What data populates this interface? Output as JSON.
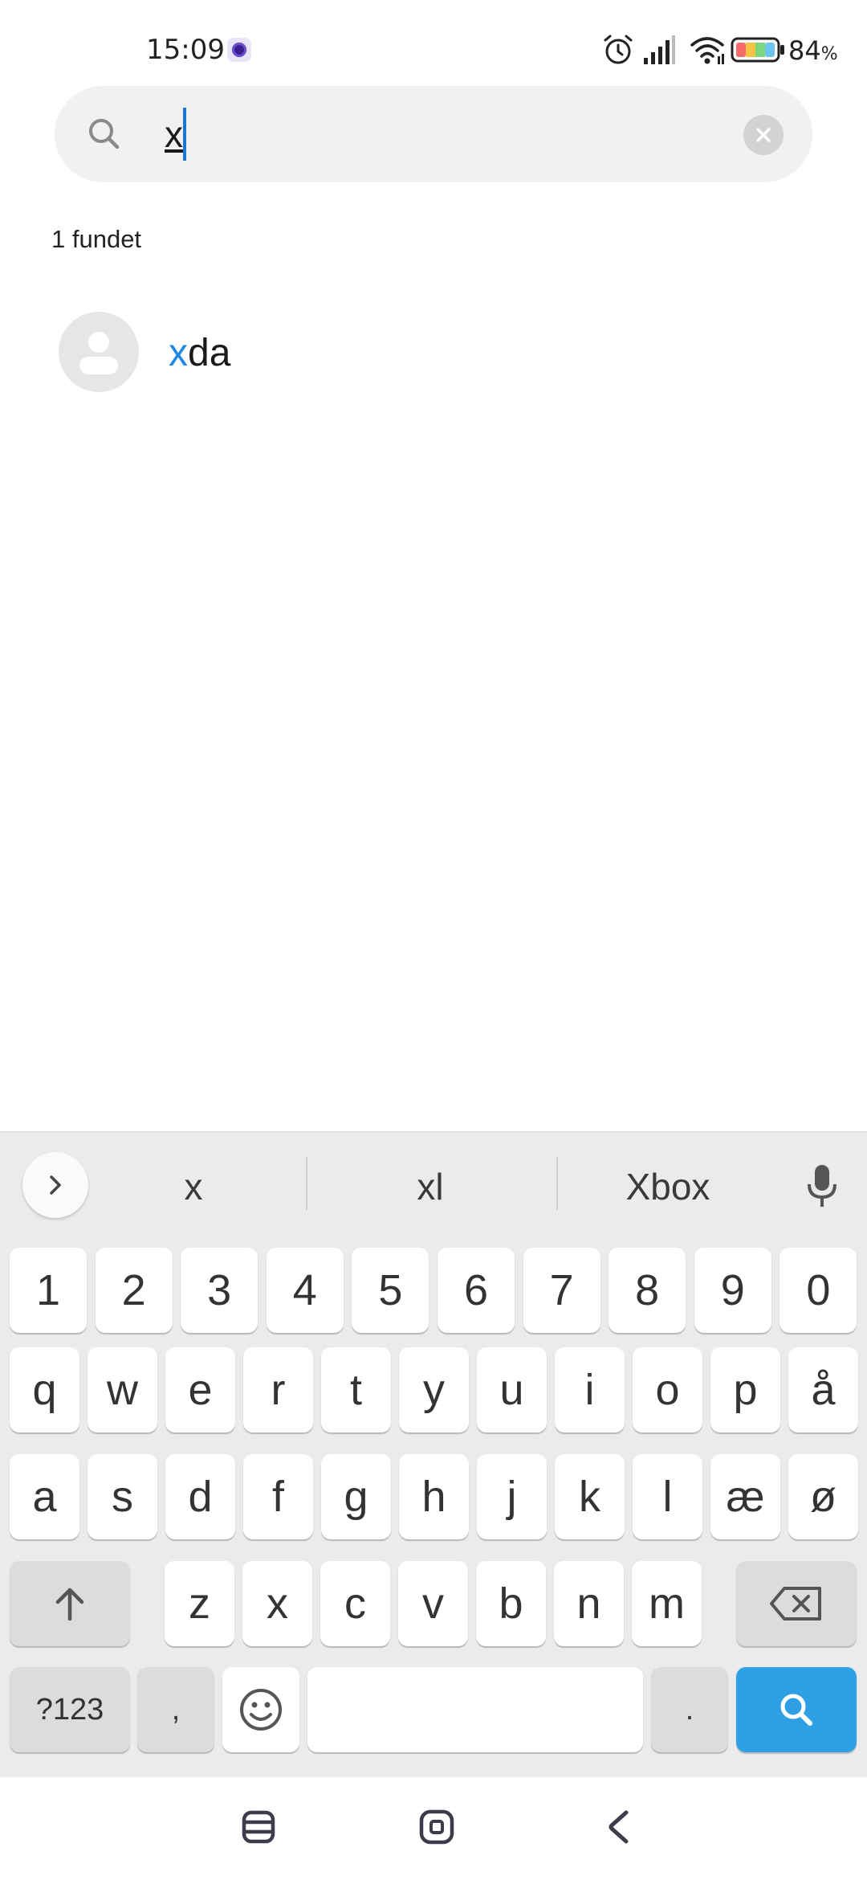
{
  "status_bar": {
    "time": "15:09",
    "battery_value": "84",
    "battery_unit": "%"
  },
  "search": {
    "value": "x",
    "placeholder": ""
  },
  "results": {
    "count_label": "1 fundet",
    "items": [
      {
        "name_match": "x",
        "name_rest": "da"
      }
    ]
  },
  "keyboard": {
    "suggestions": [
      "x",
      "xl",
      "Xbox"
    ],
    "number_row": [
      "1",
      "2",
      "3",
      "4",
      "5",
      "6",
      "7",
      "8",
      "9",
      "0"
    ],
    "row1": [
      "q",
      "w",
      "e",
      "r",
      "t",
      "y",
      "u",
      "i",
      "o",
      "p",
      "å"
    ],
    "row2": [
      "a",
      "s",
      "d",
      "f",
      "g",
      "h",
      "j",
      "k",
      "l",
      "æ",
      "ø"
    ],
    "row3": [
      "z",
      "x",
      "c",
      "v",
      "b",
      "n",
      "m"
    ],
    "symbols_label": "?123",
    "comma_label": ",",
    "period_label": "."
  },
  "colors": {
    "accent": "#1e88e5",
    "search_key": "#2ea0e3"
  }
}
